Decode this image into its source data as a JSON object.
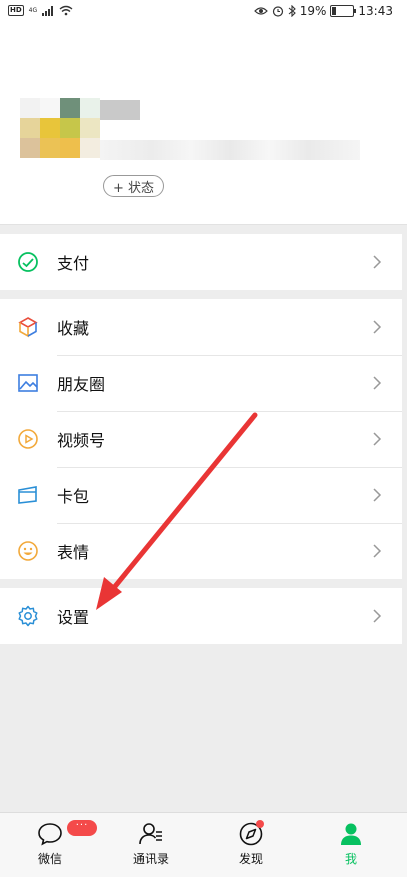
{
  "status_bar": {
    "hd": "HD",
    "network": "4G",
    "battery": "19%",
    "time": "13:43"
  },
  "profile": {
    "status_button": "+ 状态"
  },
  "menu": {
    "pay": "支付",
    "favorites": "收藏",
    "moments": "朋友圈",
    "channels": "视频号",
    "cards": "卡包",
    "stickers": "表情",
    "settings": "设置"
  },
  "tabs": {
    "chats": "微信",
    "contacts": "通讯录",
    "discover": "发现",
    "me": "我",
    "chats_badge": "···"
  },
  "colors": {
    "active_tab": "#07c160",
    "accent_green": "#07c160",
    "annotation_arrow": "#e93535"
  }
}
